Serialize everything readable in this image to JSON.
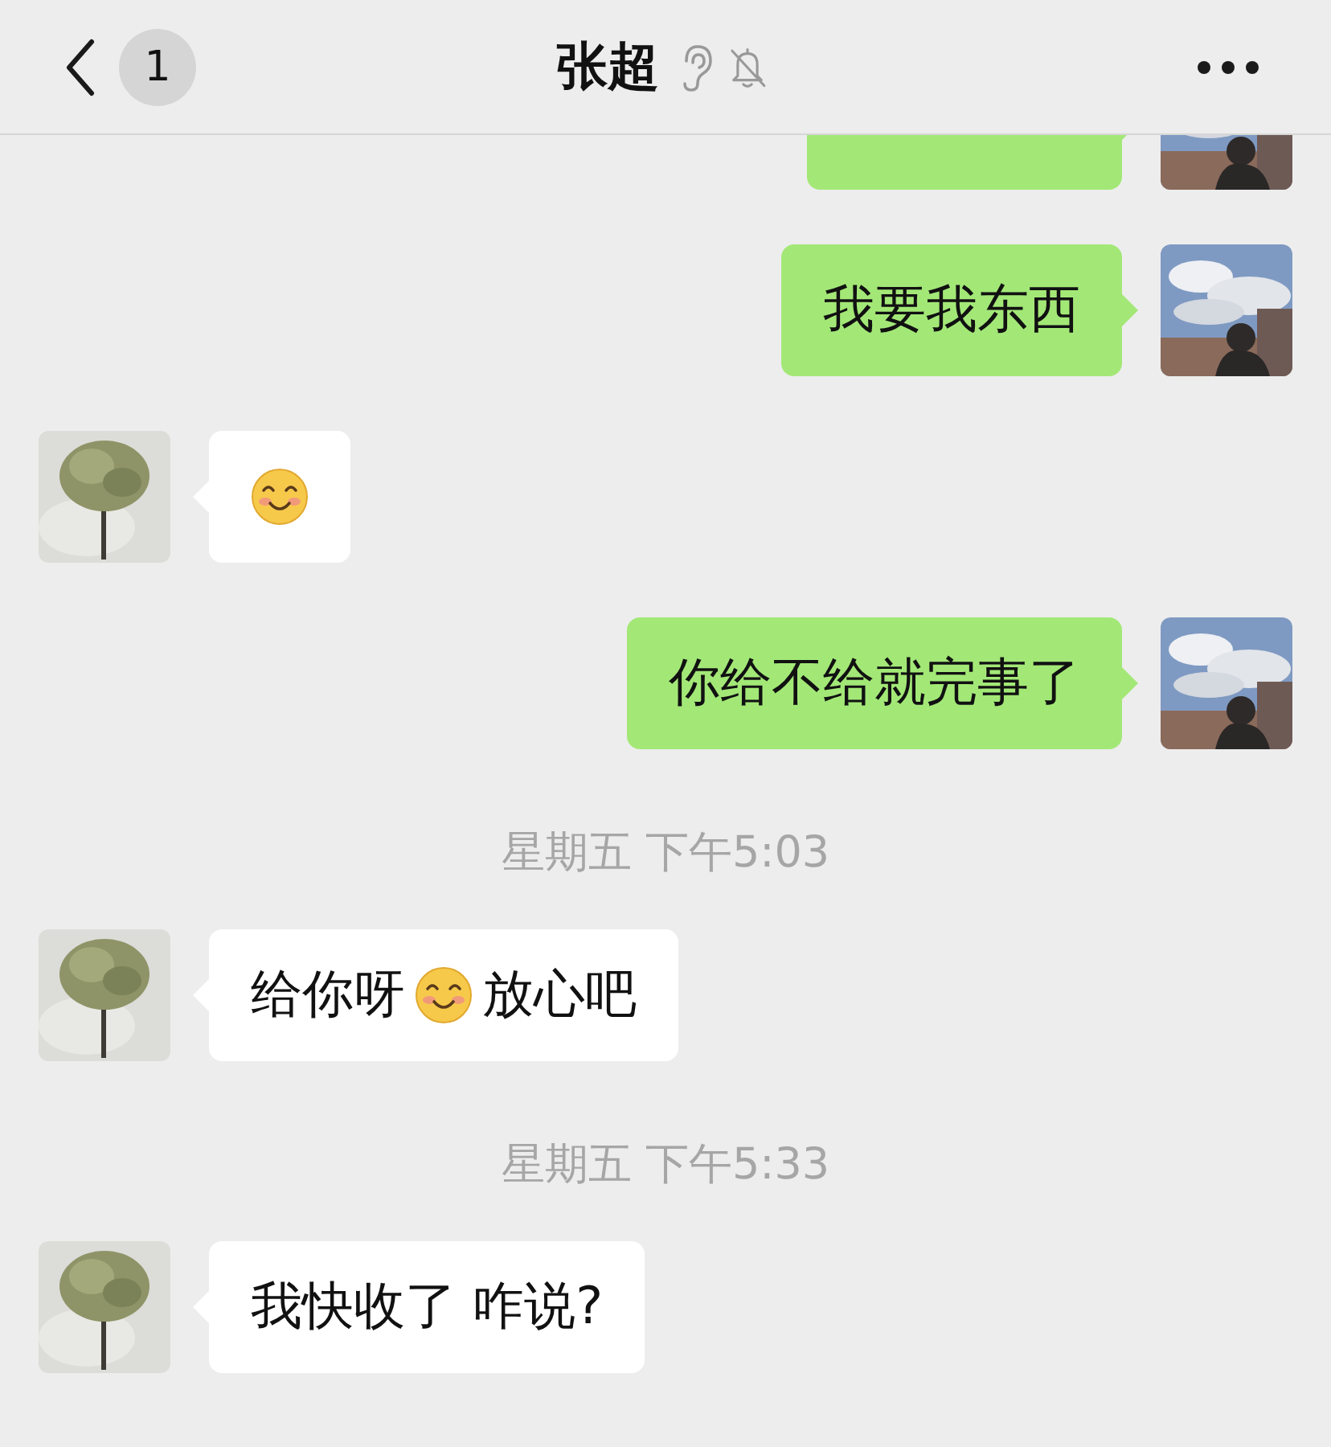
{
  "header": {
    "unread_count": "1",
    "title": "张超",
    "earpiece_mode": true,
    "muted": true
  },
  "messages": [
    {
      "kind": "outgoing",
      "cut": true
    },
    {
      "kind": "outgoing",
      "cut": false,
      "parts": [
        {
          "kind": "text",
          "text": "我要我东西"
        }
      ]
    },
    {
      "kind": "incoming",
      "cut": false,
      "parts": [
        {
          "kind": "emoji"
        }
      ]
    },
    {
      "kind": "outgoing",
      "cut": false,
      "parts": [
        {
          "kind": "text",
          "text": "你给不给就完事了"
        }
      ]
    },
    {
      "kind": "time",
      "text": "星期五 下午5:03"
    },
    {
      "kind": "incoming",
      "cut": false,
      "parts": [
        {
          "kind": "text",
          "text": "给你呀"
        },
        {
          "kind": "emoji"
        },
        {
          "kind": "text",
          "text": "放心吧"
        }
      ]
    },
    {
      "kind": "time",
      "text": "星期五 下午5:33"
    },
    {
      "kind": "incoming",
      "cut": false,
      "parts": [
        {
          "kind": "text",
          "text": "我快收了 咋说?"
        }
      ]
    }
  ]
}
